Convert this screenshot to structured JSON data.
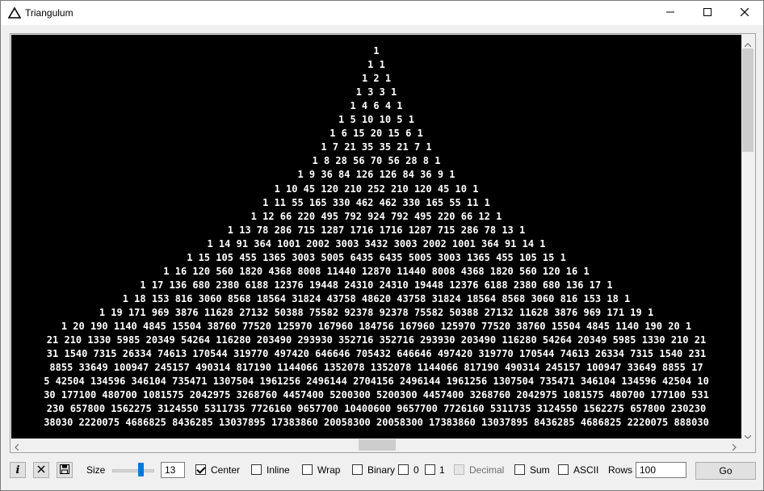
{
  "window": {
    "title": "Triangulum",
    "icon": "triangle-icon",
    "controls": [
      "minimize-icon",
      "maximize-icon",
      "close-icon"
    ]
  },
  "triangle_rows": [
    "1",
    "1 1",
    "1 2 1",
    "1 3 3 1",
    "1 4 6 4 1",
    "1 5 10 10 5 1",
    "1 6 15 20 15 6 1",
    "1 7 21 35 35 21 7 1",
    "1 8 28 56 70 56 28 8 1",
    "1 9 36 84 126 126 84 36 9 1",
    "1 10 45 120 210 252 210 120 45 10 1",
    "1 11 55 165 330 462 462 330 165 55 11 1",
    "1 12 66 220 495 792 924 792 495 220 66 12 1",
    "1 13 78 286 715 1287 1716 1716 1287 715 286 78 13 1",
    "1 14 91 364 1001 2002 3003 3432 3003 2002 1001 364 91 14 1",
    "1 15 105 455 1365 3003 5005 6435 6435 5005 3003 1365 455 105 15 1",
    "1 16 120 560 1820 4368 8008 11440 12870 11440 8008 4368 1820 560 120 16 1",
    "1 17 136 680 2380 6188 12376 19448 24310 24310 19448 12376 6188 2380 680 136 17 1",
    "1 18 153 816 3060 8568 18564 31824 43758 48620 43758 31824 18564 8568 3060 816 153 18 1",
    "1 19 171 969 3876 11628 27132 50388 75582 92378 92378 75582 50388 27132 11628 3876 969 171 19 1",
    "1 20 190 1140 4845 15504 38760 77520 125970 167960 184756 167960 125970 77520 38760 15504 4845 1140 190 20 1",
    "21 210 1330 5985 20349 54264 116280 203490 293930 352716 352716 293930 203490 116280 54264 20349 5985 1330 210 21",
    "31 1540 7315 26334 74613 170544 319770 497420 646646 705432 646646 497420 319770 170544 74613 26334 7315 1540 231",
    "8855 33649 100947 245157 490314 817190 1144066 1352078 1352078 1144066 817190 490314 245157 100947 33649 8855 17",
    "5 42504 134596 346104 735471 1307504 1961256 2496144 2704156 2496144 1961256 1307504 735471 346104 134596 42504 10",
    "30 177100 480700 1081575 2042975 3268760 4457400 5200300 5200300 4457400 3268760 2042975 1081575 480700 177100 531",
    "230 657800 1562275 3124550 5311735 7726160 9657700 10400600 9657700 7726160 5311735 3124550 1562275 657800 230230",
    "38030 2220075 4686825 8436285 13037895 17383860 20058300 20058300 17383860 13037895 8436285 4686825 2220075 888030"
  ],
  "toolbar": {
    "info_label": "i",
    "size_label": "Size",
    "size_value": "13",
    "size_slider_fraction": 0.65,
    "center_label": "Center",
    "inline_label": "Inline",
    "wrap_label": "Wrap",
    "binary_label": "Binary",
    "zero_label": "0",
    "one_label": "1",
    "decimal_label": "Decimal",
    "sum_label": "Sum",
    "ascii_label": "ASCII",
    "rows_label": "Rows",
    "rows_value": "100",
    "go_label": "Go"
  },
  "checkboxes": {
    "center": true,
    "inline": false,
    "wrap": false,
    "binary": false,
    "zero": false,
    "one": false,
    "decimal_disabled": true,
    "sum": false,
    "ascii": false
  },
  "colors": {
    "canvas_bg": "#000000",
    "canvas_text": "#ffffff",
    "slider_accent": "#007ad9"
  }
}
